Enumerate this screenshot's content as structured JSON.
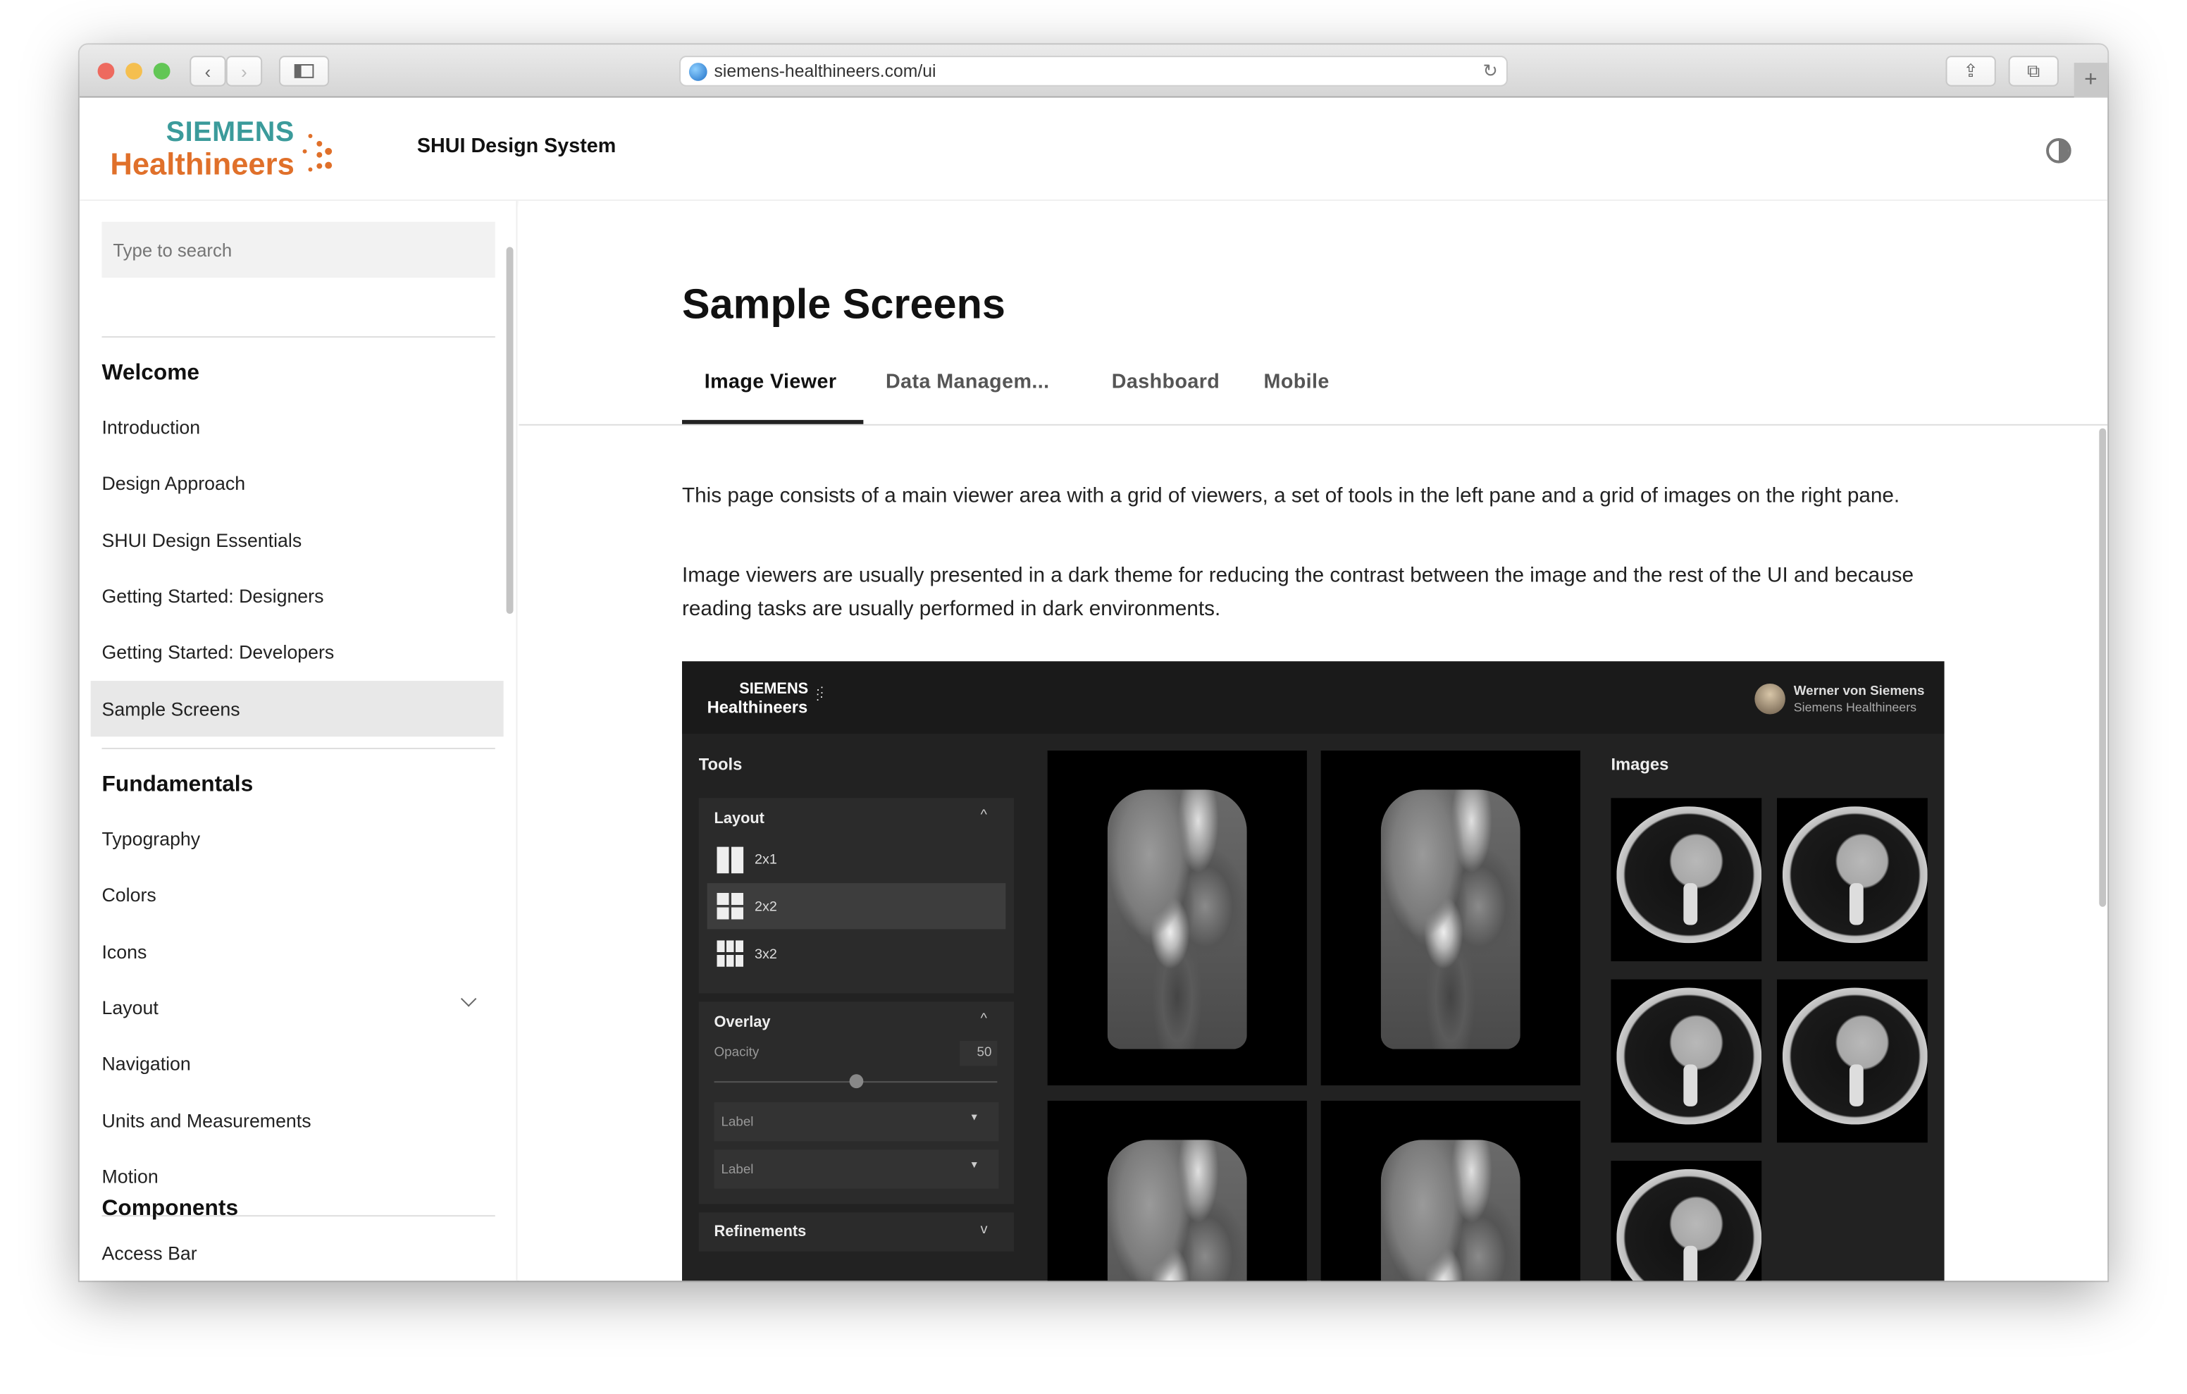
{
  "browser": {
    "url": "siemens-healthineers.com/ui",
    "icons": [
      "back-icon",
      "forward-icon",
      "sidebar-icon",
      "globe-icon",
      "reload-icon",
      "share-icon",
      "tabs-icon",
      "new-tab-icon"
    ]
  },
  "header": {
    "logo_top": "SIEMENS",
    "logo_bottom": "Healthineers",
    "title": "SHUI Design System",
    "theme_toggle_icon": "contrast-icon"
  },
  "sidebar": {
    "search_placeholder": "Type to search",
    "sections": [
      {
        "title": "Welcome",
        "items": [
          "Introduction",
          "Design Approach",
          "SHUI Design Essentials",
          "Getting Started: Designers",
          "Getting Started: Developers",
          "Sample Screens"
        ]
      },
      {
        "title": "Fundamentals",
        "items": [
          "Typography",
          "Colors",
          "Icons",
          "Layout",
          "Navigation",
          "Units and Measurements",
          "Motion"
        ]
      },
      {
        "title": "Components",
        "items": [
          "Access Bar"
        ]
      }
    ],
    "selected": "Sample Screens"
  },
  "main": {
    "title": "Sample Screens",
    "tabs": [
      "Image Viewer",
      "Data Managem...",
      "Dashboard",
      "Mobile"
    ],
    "active_tab": "Image Viewer",
    "paragraphs": [
      "This page consists of a main viewer area with a grid of viewers, a set of tools in the left pane and a grid of images on the right pane.",
      "Image viewers are usually presented in a dark theme for reducing the contrast between the image and the rest of the UI and because reading tasks are usually performed in dark environments."
    ]
  },
  "demo": {
    "logo_top": "SIEMENS",
    "logo_bottom": "Healthineers",
    "user_name": "Werner von Siemens",
    "user_org": "Siemens Healthineers",
    "tools_title": "Tools",
    "layout": {
      "title": "Layout",
      "options": [
        "2x1",
        "2x2",
        "3x2"
      ],
      "selected": "2x2"
    },
    "overlay": {
      "title": "Overlay",
      "opacity_label": "Opacity",
      "opacity_value": "50",
      "slider_percent": 50,
      "select1": "Label",
      "select2": "Label"
    },
    "refinements": {
      "title": "Refinements"
    },
    "images_title": "Images"
  },
  "colors": {
    "brand_teal": "#3b9b9b",
    "brand_orange": "#e0702a",
    "dark_bg": "#222222"
  }
}
